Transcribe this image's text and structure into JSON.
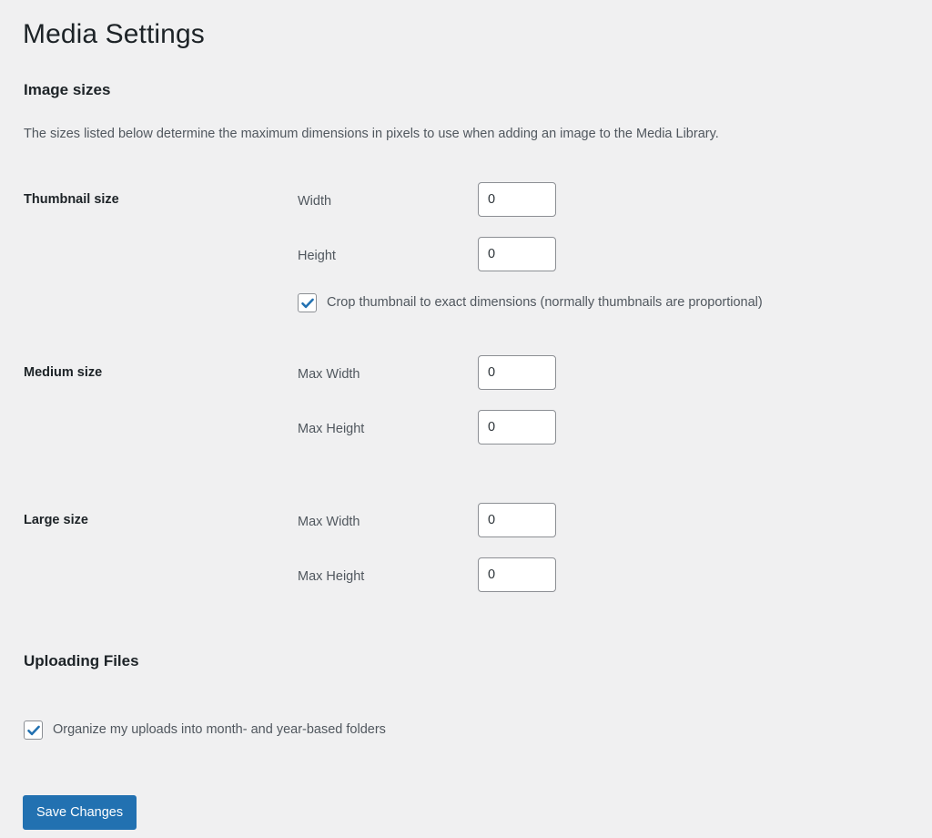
{
  "page": {
    "title": "Media Settings",
    "background_color": "#f0f0f1",
    "text_color": "#3c434a",
    "accent_color": "#2271b1"
  },
  "image_sizes": {
    "heading": "Image sizes",
    "description": "The sizes listed below determine the maximum dimensions in pixels to use when adding an image to the Media Library.",
    "rows": [
      {
        "label": "Thumbnail size",
        "fields": [
          {
            "label": "Width",
            "value": "0"
          },
          {
            "label": "Height",
            "value": "0"
          }
        ]
      },
      {
        "label": "Medium size",
        "fields": [
          {
            "label": "Max Width",
            "value": "0"
          },
          {
            "label": "Max Height",
            "value": "0"
          }
        ]
      },
      {
        "label": "Large size",
        "fields": [
          {
            "label": "Max Width",
            "value": "0"
          },
          {
            "label": "Max Height",
            "value": "0"
          }
        ]
      }
    ],
    "crop_checkbox": {
      "label": "Crop thumbnail to exact dimensions (normally thumbnails are proportional)",
      "checked": true,
      "check_color": "#2271b1"
    }
  },
  "uploading_files": {
    "heading": "Uploading Files",
    "organize_checkbox": {
      "label": "Organize my uploads into month- and year-based folders",
      "checked": true,
      "check_color": "#2271b1"
    }
  },
  "footer": {
    "save_label": "Save Changes"
  }
}
